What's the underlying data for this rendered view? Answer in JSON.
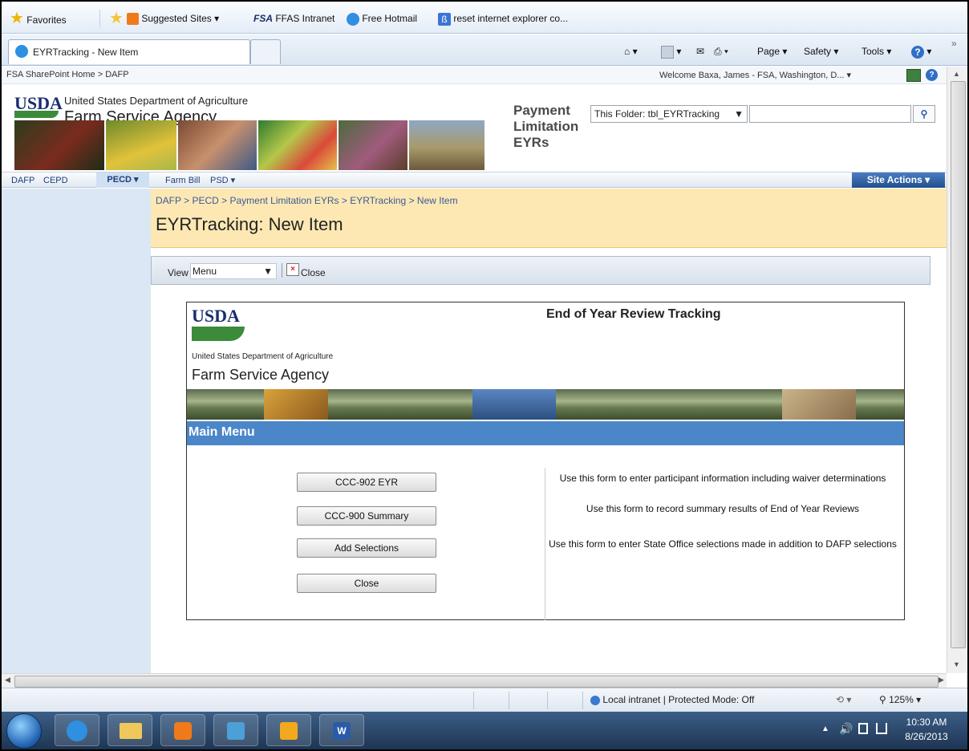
{
  "favorites_bar": {
    "favorites_label": "Favorites",
    "links": [
      "Suggested Sites ▾",
      "FFAS Intranet",
      "Free Hotmail",
      "reset internet explorer co..."
    ],
    "fsa_logo_text": "FSA"
  },
  "tab": {
    "title": "EYRTracking - New Item"
  },
  "command_bar": {
    "page": "Page ▾",
    "safety": "Safety ▾",
    "tools": "Tools ▾"
  },
  "sharepoint": {
    "breadcrumb_top": "FSA SharePoint Home > DAFP",
    "welcome": "Welcome Baxa, James - FSA, Washington, D... ▾",
    "org_line": "United States Department of Agriculture",
    "agency": "Farm Service Agency",
    "usda": "USDA",
    "site_title_lines": [
      "Payment",
      "Limitation",
      "EYRs"
    ],
    "search_scope": "This Folder: tbl_EYRTracking",
    "search_value": "",
    "nav_items": [
      "DAFP",
      "CEPD",
      "PECD ▾",
      "Farm Bill",
      "PSD ▾"
    ],
    "site_actions": "Site Actions ▾",
    "page_breadcrumb": "DAFP > PECD > Payment Limitation EYRs > EYRTracking > New Item",
    "page_title": "EYRTracking: New Item",
    "view_label": "View",
    "view_value": "Menu",
    "close_label": "Close"
  },
  "form": {
    "usda": "USDA",
    "org_line": "United States Department of Agriculture",
    "agency": "Farm Service Agency",
    "title": "End of Year Review Tracking",
    "main_menu": "Main Menu",
    "buttons": [
      "CCC-902 EYR",
      "CCC-900 Summary",
      "Add Selections",
      "Close"
    ],
    "descriptions": [
      "Use this form to enter participant information including waiver determinations",
      "Use this form to record summary results of End of Year Reviews",
      "Use this form to enter State Office selections made in addition to DAFP selections"
    ]
  },
  "status": {
    "zone": "Local intranet | Protected Mode: Off",
    "zoom": "125%"
  },
  "taskbar": {
    "time": "10:30 AM",
    "date": "8/26/2013"
  },
  "colors": {
    "main_menu_bar": "#4a86c8",
    "title_area": "#fde8b3",
    "left_nav": "#dbe7f5",
    "topnav_selected": "#1f3e7a"
  }
}
